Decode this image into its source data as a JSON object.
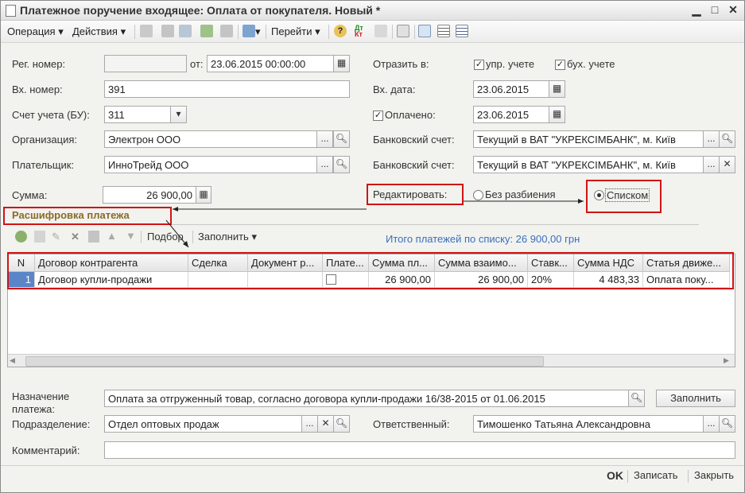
{
  "window": {
    "title": "Платежное поручение входящее: Оплата от покупателя. Новый *"
  },
  "toolbar": {
    "operation": "Операция",
    "actions": "Действия",
    "goto": "Перейти"
  },
  "form": {
    "reg_number_label": "Рег. номер:",
    "reg_number_value": "",
    "from_label": "от:",
    "from_value": "23.06.2015 00:00:00",
    "in_number_label": "Вх. номер:",
    "in_number_value": "391",
    "account_label": "Счет учета (БУ):",
    "account_value": "311",
    "organization_label": "Организация:",
    "organization_value": "Электрон ООО",
    "payer_label": "Плательщик:",
    "payer_value": "ИнноТрейд ООО",
    "sum_label": "Сумма:",
    "sum_value": "26 900,00",
    "reflect_label": "Отразить в:",
    "mgmt_accounting": "упр. учете",
    "book_accounting": "бух. учете",
    "in_date_label": "Вх. дата:",
    "in_date_value": "23.06.2015",
    "paid_label": "Оплачено:",
    "paid_value": "23.06.2015",
    "bank_account_label": "Банковский счет:",
    "bank_account_value": "Текущий в ВАТ \"УКРЕКСІМБАНК\", м. Київ",
    "bank_account2_label": "Банковский счет:",
    "bank_account2_value": "Текущий в ВАТ \"УКРЕКСІМБАНК\", м. Київ",
    "edit_label": "Редактировать:",
    "no_split_label": "Без разбиения",
    "list_label": "Списком"
  },
  "section": {
    "title": "Расшифровка платежа",
    "selection": "Подбор",
    "fill": "Заполнить",
    "total": "Итого платежей по списку: 26 900,00 грн"
  },
  "table": {
    "headers": [
      "N",
      "Договор контрагента",
      "Сделка",
      "Документ р...",
      "Плате...",
      "Сумма пл...",
      "Сумма взаимо...",
      "Ставк...",
      "Сумма НДС",
      "Статья движе..."
    ],
    "rows": [
      {
        "n": "1",
        "contract": "Договор купли-продажи",
        "deal": "",
        "doc": "",
        "sum_pay": "26 900,00",
        "sum_mutual": "26 900,00",
        "rate": "20%",
        "vat": "4 483,33",
        "article": "Оплата поку..."
      }
    ]
  },
  "bottom": {
    "purpose_label_1": "Назначение",
    "purpose_label_2": "платежа:",
    "purpose_value": "Оплата за отгруженный товар, согласно договора купли-продажи 16/38-2015 от 01.06.2015",
    "fill_button": "Заполнить",
    "department_label": "Подразделение:",
    "department_value": "Отдел оптовых продаж",
    "responsible_label": "Ответственный:",
    "responsible_value": "Тимошенко Татьяна Александровна",
    "comment_label": "Комментарий:",
    "comment_value": ""
  },
  "footer": {
    "ok": "OK",
    "save": "Записать",
    "close": "Закрыть"
  }
}
